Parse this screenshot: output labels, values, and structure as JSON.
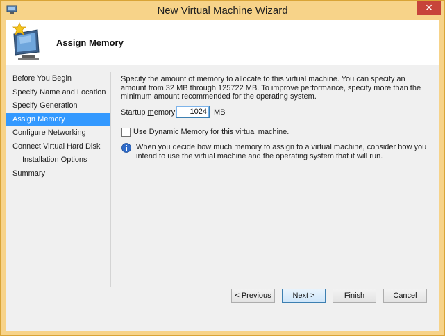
{
  "window": {
    "title": "New Virtual Machine Wizard",
    "close_label": "✕"
  },
  "header": {
    "heading": "Assign Memory"
  },
  "nav": {
    "items": [
      {
        "label": "Before You Begin",
        "selected": false,
        "indent": false
      },
      {
        "label": "Specify Name and Location",
        "selected": false,
        "indent": false
      },
      {
        "label": "Specify Generation",
        "selected": false,
        "indent": false
      },
      {
        "label": "Assign Memory",
        "selected": true,
        "indent": false
      },
      {
        "label": "Configure Networking",
        "selected": false,
        "indent": false
      },
      {
        "label": "Connect Virtual Hard Disk",
        "selected": false,
        "indent": false
      },
      {
        "label": "Installation Options",
        "selected": false,
        "indent": true
      },
      {
        "label": "Summary",
        "selected": false,
        "indent": false
      }
    ]
  },
  "content": {
    "description": "Specify the amount of memory to allocate to this virtual machine. You can specify an amount from 32 MB through 125722 MB. To improve performance, specify more than the minimum amount recommended for the operating system.",
    "startup_memory_label_pre": "Startup ",
    "startup_memory_label_accel": "m",
    "startup_memory_label_post": "emory:",
    "startup_memory_value": "1024",
    "startup_memory_unit": "MB",
    "dynamic_memory_accel": "U",
    "dynamic_memory_label": "se Dynamic Memory for this virtual machine.",
    "dynamic_memory_checked": false,
    "info_text": "When you decide how much memory to assign to a virtual machine, consider how you intend to use the virtual machine and the operating system that it will run."
  },
  "footer": {
    "previous_pre": "< ",
    "previous_accel": "P",
    "previous_post": "revious",
    "next_accel": "N",
    "next_post": "ext >",
    "finish_accel": "F",
    "finish_post": "inish",
    "cancel_label": "Cancel"
  },
  "colors": {
    "title_bar": "#f7d389",
    "selection": "#3399ff",
    "close_button": "#c7443a"
  }
}
